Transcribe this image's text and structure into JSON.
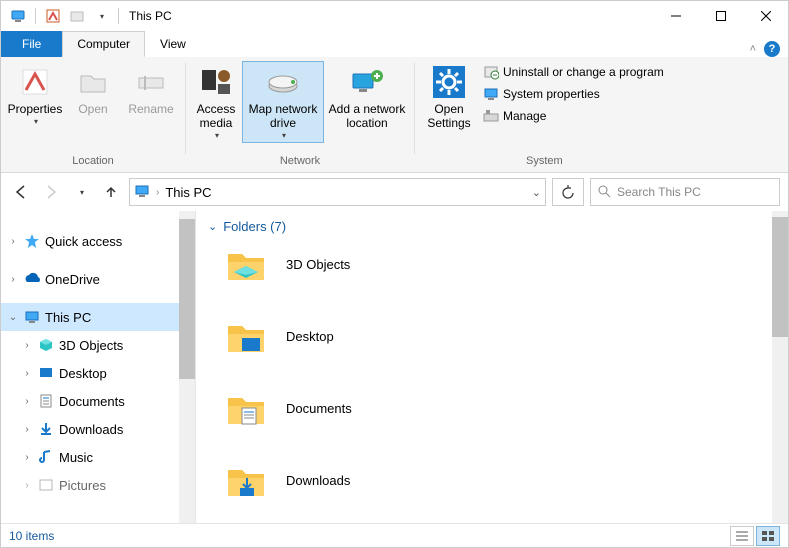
{
  "title": "This PC",
  "tabs": {
    "file": "File",
    "computer": "Computer",
    "view": "View"
  },
  "ribbon": {
    "location": {
      "label": "Location",
      "properties": "Properties",
      "open": "Open",
      "rename": "Rename"
    },
    "network": {
      "label": "Network",
      "access_media": "Access media",
      "map_drive": "Map network drive",
      "add_location": "Add a network location"
    },
    "system": {
      "label": "System",
      "open_settings": "Open Settings",
      "uninstall": "Uninstall or change a program",
      "system_properties": "System properties",
      "manage": "Manage"
    }
  },
  "address": {
    "crumb1": "This PC",
    "search_placeholder": "Search This PC"
  },
  "tree": {
    "quick_access": "Quick access",
    "onedrive": "OneDrive",
    "this_pc": "This PC",
    "objects3d": "3D Objects",
    "desktop": "Desktop",
    "documents": "Documents",
    "downloads": "Downloads",
    "music": "Music",
    "pictures": "Pictures"
  },
  "content": {
    "section_label": "Folders (7)",
    "items": {
      "objects3d": "3D Objects",
      "desktop": "Desktop",
      "documents": "Documents",
      "downloads": "Downloads"
    }
  },
  "status": {
    "count": "10 items"
  }
}
